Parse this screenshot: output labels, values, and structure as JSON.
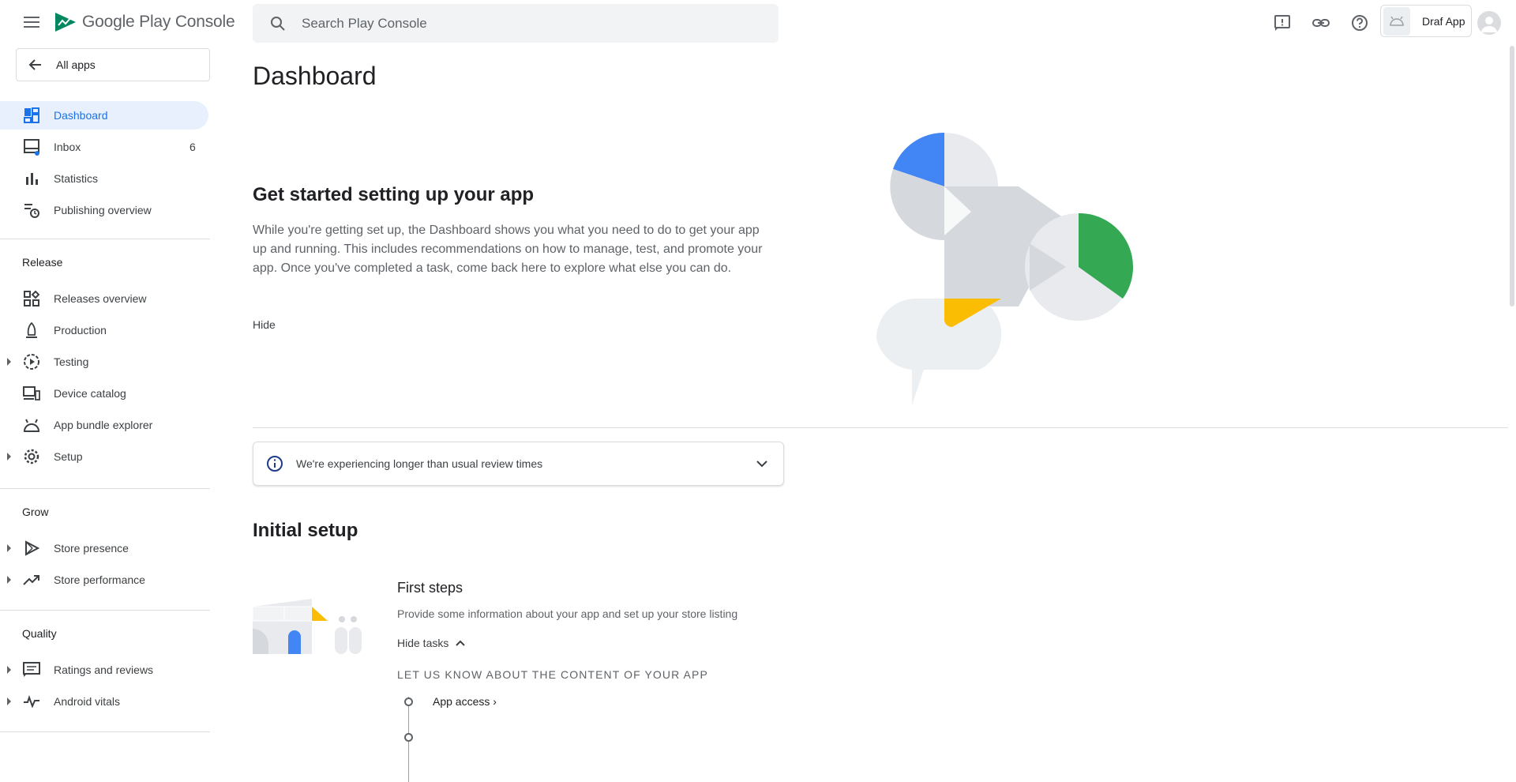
{
  "header": {
    "logo_text": "Google Play Console",
    "search_placeholder": "Search Play Console",
    "app_name": "Draf App"
  },
  "sidebar": {
    "all_apps_label": "All apps",
    "items": [
      {
        "label": "Dashboard"
      },
      {
        "label": "Inbox",
        "count": "6"
      },
      {
        "label": "Statistics"
      },
      {
        "label": "Publishing overview"
      }
    ],
    "release_header": "Release",
    "release_items": [
      {
        "label": "Releases overview"
      },
      {
        "label": "Production"
      },
      {
        "label": "Testing"
      },
      {
        "label": "Device catalog"
      },
      {
        "label": "App bundle explorer"
      },
      {
        "label": "Setup"
      }
    ],
    "grow_header": "Grow",
    "grow_items": [
      {
        "label": "Store presence"
      },
      {
        "label": "Store performance"
      }
    ],
    "quality_header": "Quality",
    "quality_items": [
      {
        "label": "Ratings and reviews"
      },
      {
        "label": "Android vitals"
      }
    ]
  },
  "main": {
    "title": "Dashboard",
    "get_started_title": "Get started setting up your app",
    "get_started_desc": "While you're getting set up, the Dashboard shows you what you need to do to get your app up and running. This includes recommendations on how to manage, test, and promote your app. Once you've completed a task, come back here to explore what else you can do.",
    "hide_label": "Hide",
    "banner_text": "We're experiencing longer than usual review times",
    "initial_setup_title": "Initial setup",
    "first_steps_title": "First steps",
    "first_steps_desc": "Provide some information about your app and set up your store listing",
    "hide_tasks_label": "Hide tasks",
    "task_section_header": "LET US KNOW ABOUT THE CONTENT OF YOUR APP",
    "task_item": "App access ›"
  },
  "colors": {
    "accent": "#1a73e8",
    "active_bg": "#e8f0fe",
    "green": "#34a853",
    "yellow": "#fbbc04",
    "blue": "#4285f4"
  }
}
